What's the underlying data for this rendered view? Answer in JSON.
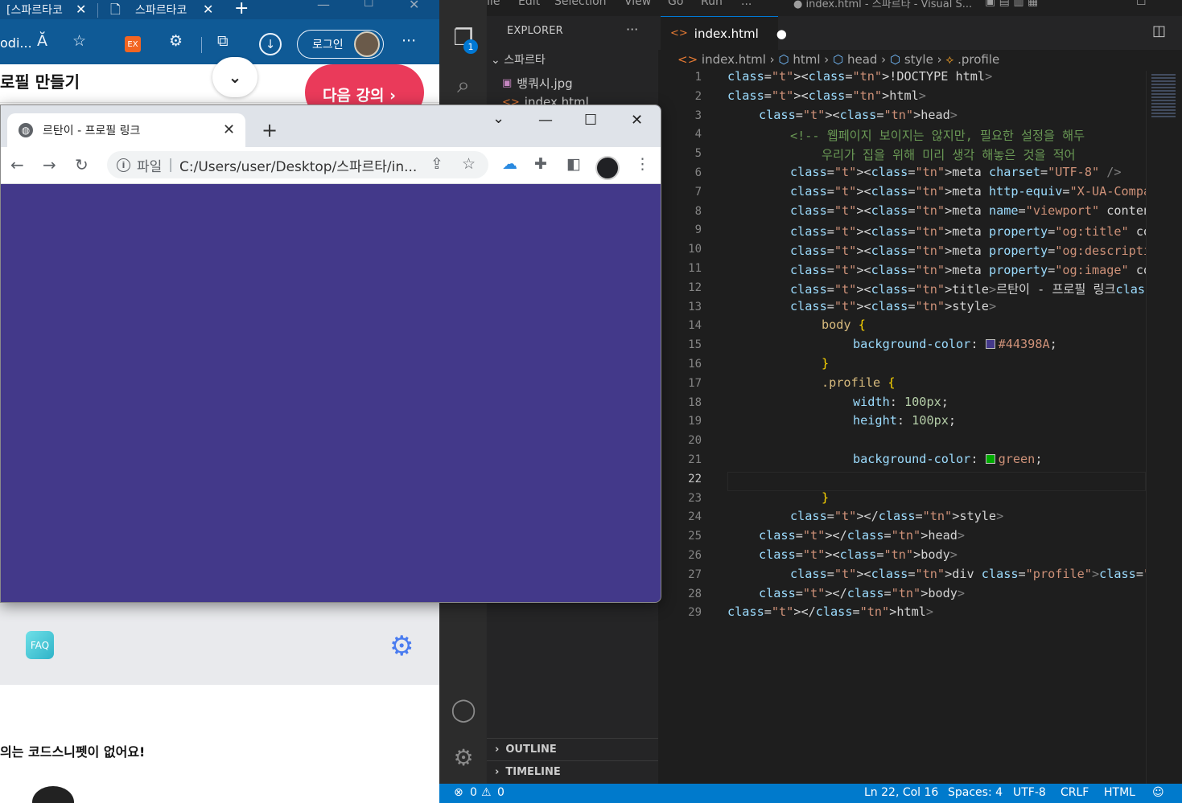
{
  "edge": {
    "tabs": [
      {
        "label": "[스파르타코"
      },
      {
        "label": "스파르타코"
      }
    ],
    "new_tab": "+",
    "address_partial": "odi...",
    "read_aloud": "Ă",
    "login_label": "로그인",
    "page_title": "로필 만들기",
    "next_button": "다음 강의 ›",
    "faq_label": "FAQ",
    "empty_message": "의는 코드스니펫이 없어요!"
  },
  "chrome": {
    "tab_title": "르탄이 - 프로필 링크",
    "tab_close": "✕",
    "new_tab": "+",
    "omnibox_label": "파일",
    "omnibox_sep": "|",
    "url": "C:/Users/user/Desktop/스파르타/in...",
    "body_bg": "#43398A"
  },
  "vscode": {
    "menu": [
      "File",
      "Edit",
      "Selection",
      "View",
      "Go",
      "Run",
      "...",
      "● index.html - 스파르타 - Visual S..."
    ],
    "explorer_title": "EXPLORER",
    "explorer_more": "···",
    "folder": "스파르타",
    "files": [
      {
        "name": "뱅쿼시.jpg"
      },
      {
        "name": "index.html"
      }
    ],
    "activity_badge": "1",
    "active_tab": "index.html",
    "tab_modified": "●",
    "breadcrumb": [
      "index.html",
      "html",
      "head",
      "style",
      ".profile"
    ],
    "outline": "OUTLINE",
    "timeline": "TIMELINE",
    "current_line": 22,
    "code_lines": [
      "<!DOCTYPE html>",
      "<html>",
      "<head>",
      "<!-- 웹페이지 보이지는 않지만, 필요한 설정을 해두",
      "우리가 집을 위해 미리 생각 해놓은 것을 적어",
      "<meta charset=\"UTF-8\" />",
      "<meta http-equiv=\"X-UA-Compatible\" content=\"IE",
      "<meta name=\"viewport\" content=\"width=device-wi",
      "<meta property=\"og:title\" content=\"르탄이 - 프",
      "<meta property=\"og:description\" content=\"어서오",
      "<meta property=\"og:image\" content=\"공유할 이미",
      "<title>르탄이 - 프로필 링크</title>",
      "<style>",
      "body {",
      "background-color: #44398A;",
      "}",
      ".profile {",
      "width: 100px;",
      "height: 100px;",
      "",
      "background-color: green;",
      "",
      "}",
      "</style>",
      "</head>",
      "<body>",
      "<div class=\"profile\"></div>",
      "</body>",
      "</html>"
    ],
    "status": {
      "errors": "0",
      "warnings": "0",
      "position": "Ln 22, Col 16",
      "spaces": "Spaces: 4",
      "encoding": "UTF-8",
      "eol": "CRLF",
      "language": "HTML"
    },
    "colors": {
      "swatch_body": "#44398A",
      "swatch_profile": "#00AA00"
    }
  }
}
